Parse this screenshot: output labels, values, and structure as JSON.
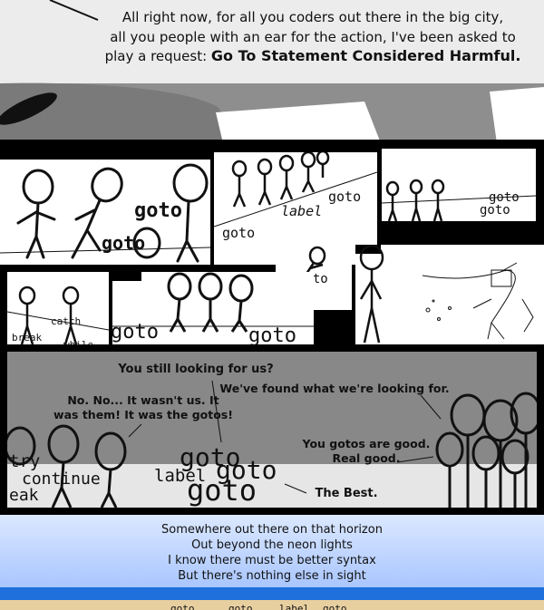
{
  "header": {
    "line1": "All right now, for all you coders out there in the big city,",
    "line2": "all you people with an ear for the action, I've been asked to",
    "line3_prefix": "play a request: ",
    "line3_title": "Go To Statement Considered Harmful."
  },
  "montage": {
    "p1_goto1": "goto",
    "p1_goto2": "goto",
    "p2_goto1": "goto",
    "p2_label": "label",
    "p2_goto2": "goto",
    "p3_goto1": "goto",
    "p3_goto2": "goto",
    "p4_goto": "goto",
    "p6_catch": "catch",
    "p6_break": "break",
    "p6_while": "while",
    "p7_goto1": "goto",
    "p7_goto2": "goto"
  },
  "scene": {
    "q_still_looking": "You still looking for us?",
    "a_wasnt_us_1": "No. No... It wasn't us. It",
    "a_wasnt_us_2": "was them! It was the gotos!",
    "found": "We've found what we're looking for.",
    "good_1": "You gotos are good.",
    "good_2": "Real good.",
    "best": "The Best.",
    "kw_try": "try",
    "kw_continue": "continue",
    "kw_break": "eak",
    "big_goto1": "goto",
    "big_label": "label",
    "big_goto2": "goto",
    "big_goto3": "goto"
  },
  "lyrics": {
    "l1": "Somewhere out there on that horizon",
    "l2": "Out beyond the neon lights",
    "l3": "I know there must be better syntax",
    "l4": "But there's nothing else in sight"
  },
  "footer": {
    "w1": "goto",
    "w2": "goto",
    "w3": "label",
    "w4": "goto"
  },
  "colors": {
    "panel_gray": "#888888",
    "sky_top": "#d6e5ff",
    "sky_bottom": "#a8c6ff",
    "band_blue": "#1f6fdc",
    "sand": "#e8cfa0"
  }
}
